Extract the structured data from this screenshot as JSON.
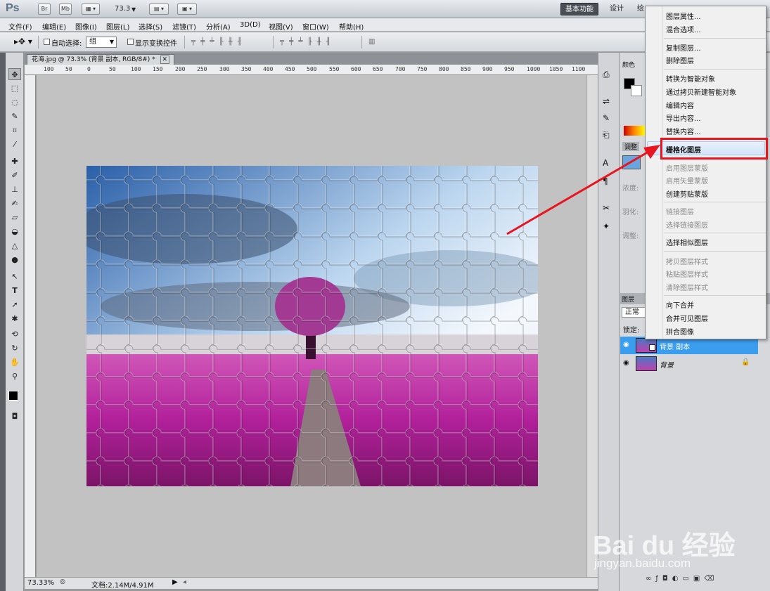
{
  "app": {
    "logo": "Ps",
    "badges": [
      "Br",
      "Mb"
    ],
    "zoom": "73.3",
    "workspaces": [
      "基本功能",
      "设计",
      "绘"
    ]
  },
  "menu": [
    "文件(F)",
    "编辑(E)",
    "图像(I)",
    "图层(L)",
    "选择(S)",
    "滤镜(T)",
    "分析(A)",
    "3D(D)",
    "视图(V)",
    "窗口(W)",
    "帮助(H)"
  ],
  "options": {
    "auto_select_label": "自动选择:",
    "auto_select_value": "组",
    "show_transform_label": "显示变换控件"
  },
  "document": {
    "tab": "花海.jpg @ 73.3% (背景 副本, RGB/8#) *",
    "zoom_status": "73.33%",
    "doc_size": "文档:2.14M/4.91M"
  },
  "ruler": {
    "h_ticks": [
      "100",
      "50",
      "0",
      "50",
      "100",
      "150",
      "200",
      "250",
      "300",
      "350",
      "400",
      "450",
      "500",
      "550",
      "600",
      "650",
      "700",
      "750",
      "800",
      "850",
      "900",
      "950",
      "1000",
      "1050",
      "1100"
    ]
  },
  "tools": [
    "move",
    "marquee",
    "lasso",
    "quick-select",
    "crop",
    "eyedropper",
    "healing",
    "brush",
    "stamp",
    "history-brush",
    "eraser",
    "paint-bucket",
    "blur",
    "dodge",
    "path-select",
    "type",
    "direct-select",
    "custom-shape",
    "3d-rotate",
    "3d-orbit",
    "hand",
    "zoom"
  ],
  "panels": {
    "color_tab": "颜色",
    "adjust_tab": "调整",
    "density_label": "浓度:",
    "feather_label": "羽化:",
    "refine_label": "调整:",
    "layers_tab": "图层",
    "blend_mode": "正常",
    "lock_label": "锁定:"
  },
  "layers": [
    {
      "name": "背景 副本",
      "selected": true
    },
    {
      "name": "背景",
      "selected": false
    }
  ],
  "context_menu": {
    "groups": [
      [
        {
          "label": "图层属性...",
          "enabled": true
        },
        {
          "label": "混合选项...",
          "enabled": true
        }
      ],
      [
        {
          "label": "复制图层...",
          "enabled": true
        },
        {
          "label": "删除图层",
          "enabled": true
        }
      ],
      [
        {
          "label": "转换为智能对象",
          "enabled": true
        },
        {
          "label": "通过拷贝新建智能对象",
          "enabled": true
        },
        {
          "label": "编辑内容",
          "enabled": true
        },
        {
          "label": "导出内容...",
          "enabled": true
        },
        {
          "label": "替换内容...",
          "enabled": true
        }
      ],
      [
        {
          "label": "栅格化图层",
          "enabled": true,
          "highlighted": true
        }
      ],
      [
        {
          "label": "启用图层蒙版",
          "enabled": false
        },
        {
          "label": "启用矢量蒙版",
          "enabled": false
        },
        {
          "label": "创建剪贴蒙版",
          "enabled": true
        }
      ],
      [
        {
          "label": "链接图层",
          "enabled": false
        },
        {
          "label": "选择链接图层",
          "enabled": false
        }
      ],
      [
        {
          "label": "选择相似图层",
          "enabled": true
        }
      ],
      [
        {
          "label": "拷贝图层样式",
          "enabled": false
        },
        {
          "label": "粘贴图层样式",
          "enabled": false
        },
        {
          "label": "清除图层样式",
          "enabled": false
        }
      ],
      [
        {
          "label": "向下合并",
          "enabled": true
        },
        {
          "label": "合并可见图层",
          "enabled": true
        },
        {
          "label": "拼合图像",
          "enabled": true
        }
      ]
    ]
  },
  "colors": {
    "annotation": "#e8141e",
    "selection": "#3b9ded"
  },
  "watermark": {
    "brand": "Bai du 经验",
    "url": "jingyan.baidu.com"
  }
}
